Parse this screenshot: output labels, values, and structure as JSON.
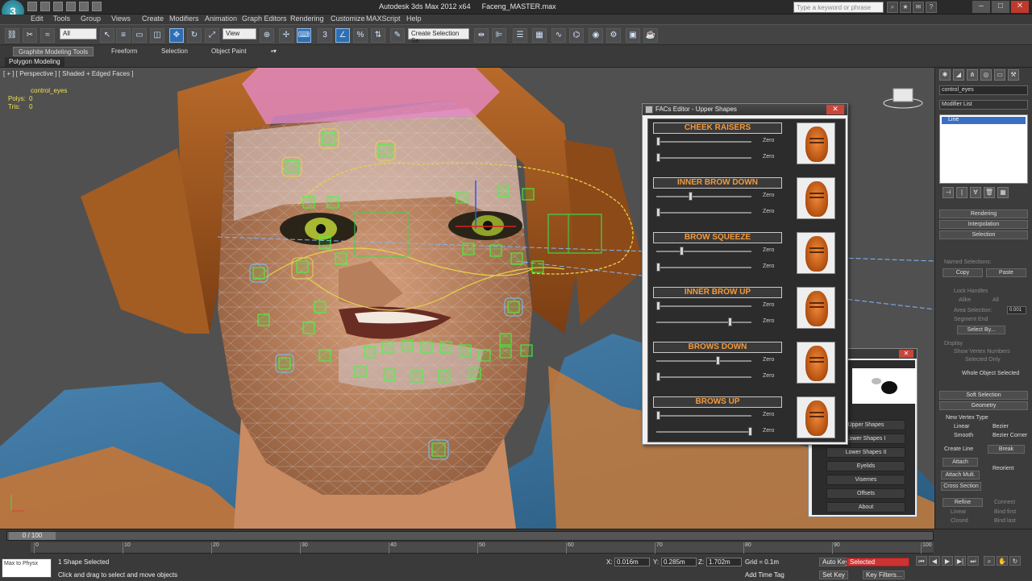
{
  "window": {
    "app_title": "Autodesk 3ds Max 2012 x64",
    "file_name": "Faceng_MASTER.max",
    "search_placeholder": "Type a keyword or phrase"
  },
  "menu": [
    "Edit",
    "Tools",
    "Group",
    "Views",
    "Create",
    "Modifiers",
    "Animation",
    "Graph Editors",
    "Rendering",
    "Customize",
    "MAXScript",
    "Help"
  ],
  "toolbar": {
    "filter_value": "All",
    "refcoord_value": "View",
    "selection_set_placeholder": "Create Selection Se"
  },
  "ribbon": {
    "tabs": [
      "Graphite Modeling Tools",
      "Freeform",
      "Selection",
      "Object Paint"
    ],
    "sub": "Polygon Modeling"
  },
  "viewport": {
    "label": "[ + ] [ Perspective ] [ Shaded + Edged Faces ]",
    "object_name": "control_eyes",
    "stats": [
      {
        "label": "Polys:",
        "value": "0"
      },
      {
        "label": "Tris:",
        "value": "0"
      }
    ]
  },
  "facs_dialog": {
    "title": "FACs Editor - Upper Shapes",
    "zero_label": "Zero",
    "shapes": [
      {
        "name": "CHEEK RAISERS",
        "slider1": 0.0,
        "slider2": 0.0
      },
      {
        "name": "INNER BROW DOWN",
        "slider1": 0.35,
        "slider2": 0.0
      },
      {
        "name": "BROW SQUEEZE",
        "slider1": 0.25,
        "slider2": 0.0
      },
      {
        "name": "INNER BROW UP",
        "slider1": 0.0,
        "slider2": 0.78
      },
      {
        "name": "BROWS DOWN",
        "slider1": 0.65,
        "slider2": 0.0
      },
      {
        "name": "BROWS UP",
        "slider1": 0.0,
        "slider2": 1.0
      }
    ]
  },
  "facs_menu": {
    "items": [
      "Upper Shapes",
      "Lower Shapes I",
      "Lower Shapes II",
      "Eyelids",
      "Visemes",
      "Offsets",
      "About"
    ]
  },
  "command_panel": {
    "object_name": "control_eyes",
    "modifier_list": "Modifier List",
    "stack_item": "Line",
    "rollouts": [
      "Rendering",
      "Interpolation",
      "Selection"
    ],
    "named_selections": "Named Selections:",
    "copy": "Copy",
    "paste": "Paste",
    "lock_handles": "Lock Handles",
    "alike": "Alike",
    "all": "All",
    "area_selection": "Area Selection:",
    "area_value": "0.001",
    "segment_end": "Segment End",
    "select_by": "Select By...",
    "display": "Display",
    "show_vertex_numbers": "Show Vertex Numbers",
    "selected_only": "Selected Only",
    "whole_object": "Whole Object Selected",
    "soft_selection": "Soft Selection",
    "geometry": "Geometry",
    "new_vertex_type": "New Vertex Type",
    "linear": "Linear",
    "bezier": "Bezier",
    "smooth": "Smooth",
    "bezier_corner": "Bezier Corner",
    "create_line": "Create Line",
    "break": "Break",
    "attach": "Attach",
    "reorient": "Reorient",
    "attach_mult": "Attach Mult.",
    "cross_section": "Cross Section",
    "refine": "Refine",
    "connect": "Connect",
    "linear2": "Linear",
    "bind_first": "Bind first",
    "closed": "Closed",
    "bind_last": "Bind last",
    "connect_copy": "Connect Copy",
    "connect2": "Connect"
  },
  "timeline": {
    "frame": "0 / 100",
    "ticks": [
      "0",
      "10",
      "20",
      "30",
      "40",
      "50",
      "60",
      "70",
      "80",
      "90",
      "100"
    ]
  },
  "status": {
    "maxscript": "Max to Physx",
    "selected": "1 Shape Selected",
    "prompt": "Click and drag to select and move objects",
    "x": "0.016m",
    "y": "0.285m",
    "z": "1.702m",
    "grid": "Grid = 0.1m",
    "add_time_tag": "Add Time Tag",
    "auto_key": "Auto Key",
    "selected_label": "Selected",
    "set_key": "Set Key",
    "key_filters": "Key Filters..."
  },
  "colors": {
    "accent": "#2e6fb3",
    "facs_heading": "#f39a3c",
    "stat_text": "#f0e050"
  }
}
